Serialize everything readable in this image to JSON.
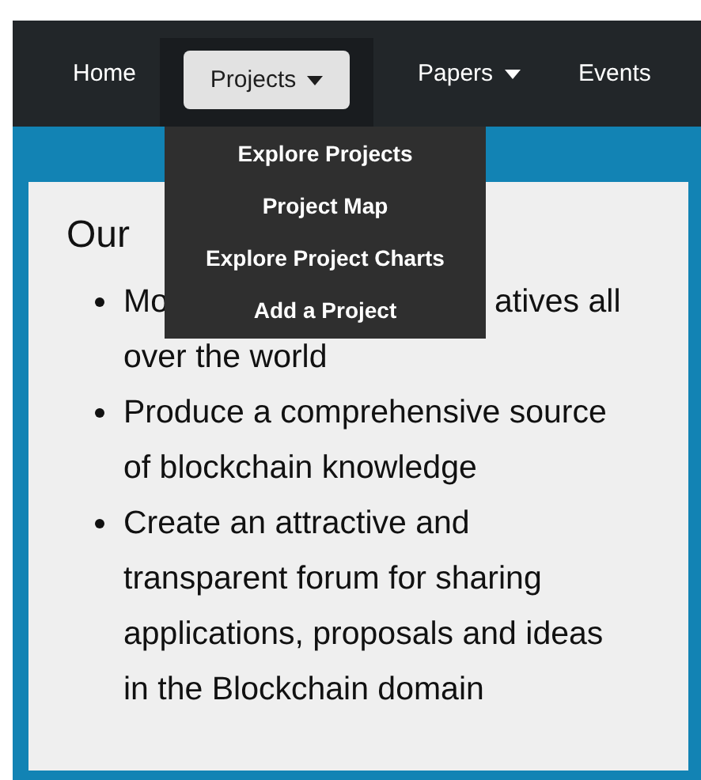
{
  "navbar": {
    "items": [
      {
        "label": "Home",
        "kind": "link",
        "selected": false
      },
      {
        "label": "Projects",
        "kind": "dropdown",
        "selected": true
      },
      {
        "label": "Papers",
        "kind": "dropdown",
        "selected": false
      },
      {
        "label": "Events",
        "kind": "link",
        "selected": false
      }
    ]
  },
  "dropdown_menu": {
    "items": [
      "Explore Projects",
      "Project Map",
      "Explore Project Charts",
      "Add a Project"
    ]
  },
  "content": {
    "heading": "Our",
    "bullets": [
      {
        "lines": [
          [
            "Mo",
            "atives all"
          ],
          [
            "over the world"
          ]
        ]
      },
      {
        "lines": [
          [
            "Produce a comprehensive source"
          ],
          [
            "of blockchain knowledge"
          ]
        ]
      },
      {
        "lines": [
          [
            "Create an attractive and"
          ],
          [
            "transparent forum for sharing"
          ],
          [
            "applications, proposals and ideas"
          ],
          [
            "in the Blockchain domain"
          ]
        ]
      }
    ]
  }
}
